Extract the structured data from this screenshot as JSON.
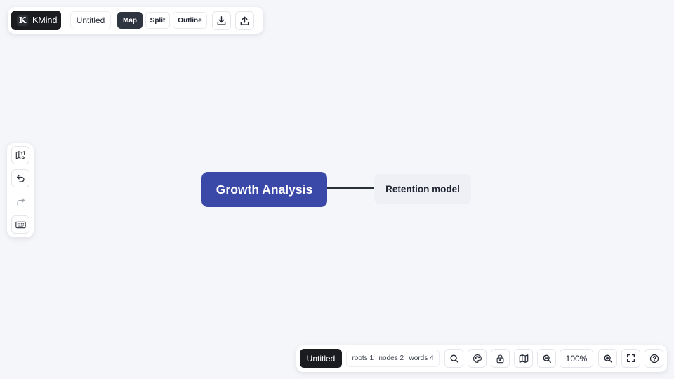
{
  "app": {
    "brand_initial": "K",
    "brand_name": "KMind",
    "document_title": "Untitled"
  },
  "toolbar": {
    "views": [
      {
        "label": "Map",
        "active": true
      },
      {
        "label": "Split",
        "active": false
      },
      {
        "label": "Outline",
        "active": false
      }
    ],
    "actions": [
      {
        "icon": "download-icon"
      },
      {
        "icon": "upload-icon"
      }
    ]
  },
  "sidebar": {
    "items": [
      {
        "icon": "map-settings-icon"
      },
      {
        "icon": "undo-icon"
      },
      {
        "icon": "redo-icon",
        "disabled": true
      },
      {
        "icon": "keyboard-icon"
      }
    ]
  },
  "mindmap": {
    "root": {
      "text": "Growth Analysis",
      "color": "#3a48a8"
    },
    "children": [
      {
        "text": "Retention model"
      }
    ]
  },
  "statusbar": {
    "document_title": "Untitled",
    "stats": {
      "roots": "roots 1",
      "nodes": "nodes 2",
      "words": "words 4"
    },
    "zoom": "100%",
    "tools": [
      "search-icon",
      "palette-icon",
      "lock-icon",
      "minimap-icon",
      "zoom-out-icon",
      "zoom-in-icon",
      "fullscreen-icon",
      "help-icon"
    ]
  }
}
